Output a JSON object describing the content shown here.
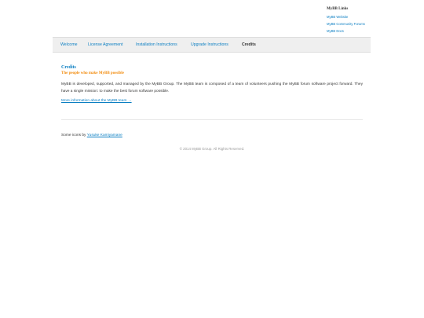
{
  "header": {
    "links_title": "MyBB Links",
    "links": [
      {
        "label": "MyBB Website"
      },
      {
        "label": "MyBB Community Forums"
      },
      {
        "label": "MyBB Docs"
      }
    ]
  },
  "nav": {
    "items": [
      {
        "label": "Welcome",
        "active": false
      },
      {
        "label": "License Agreement",
        "active": false
      },
      {
        "label": "Installation Instructions",
        "active": false
      },
      {
        "label": "Upgrade Instructions",
        "active": false
      },
      {
        "label": "Credits",
        "active": true
      }
    ]
  },
  "content": {
    "title": "Credits",
    "subtitle": "The people who make MyBB possible",
    "intro": "MyBB is developed, supported, and managed by the MyBB Group. The MyBB team is composed of a team of volunteers pushing the MyBB forum software project forward. They have a single mission: to make the best forum software possible.",
    "more_link": "More information about the MyBB team →",
    "icons_prefix": "Some icons by ",
    "icons_author": "Yusuke Kamiyamane"
  },
  "footer": {
    "copyright": "© 2014 MyBB Group. All Rights Reserved."
  },
  "colors": {
    "link": "#0a7ec2",
    "subtitle": "#f28c0f",
    "nav_bg": "#efefef"
  }
}
